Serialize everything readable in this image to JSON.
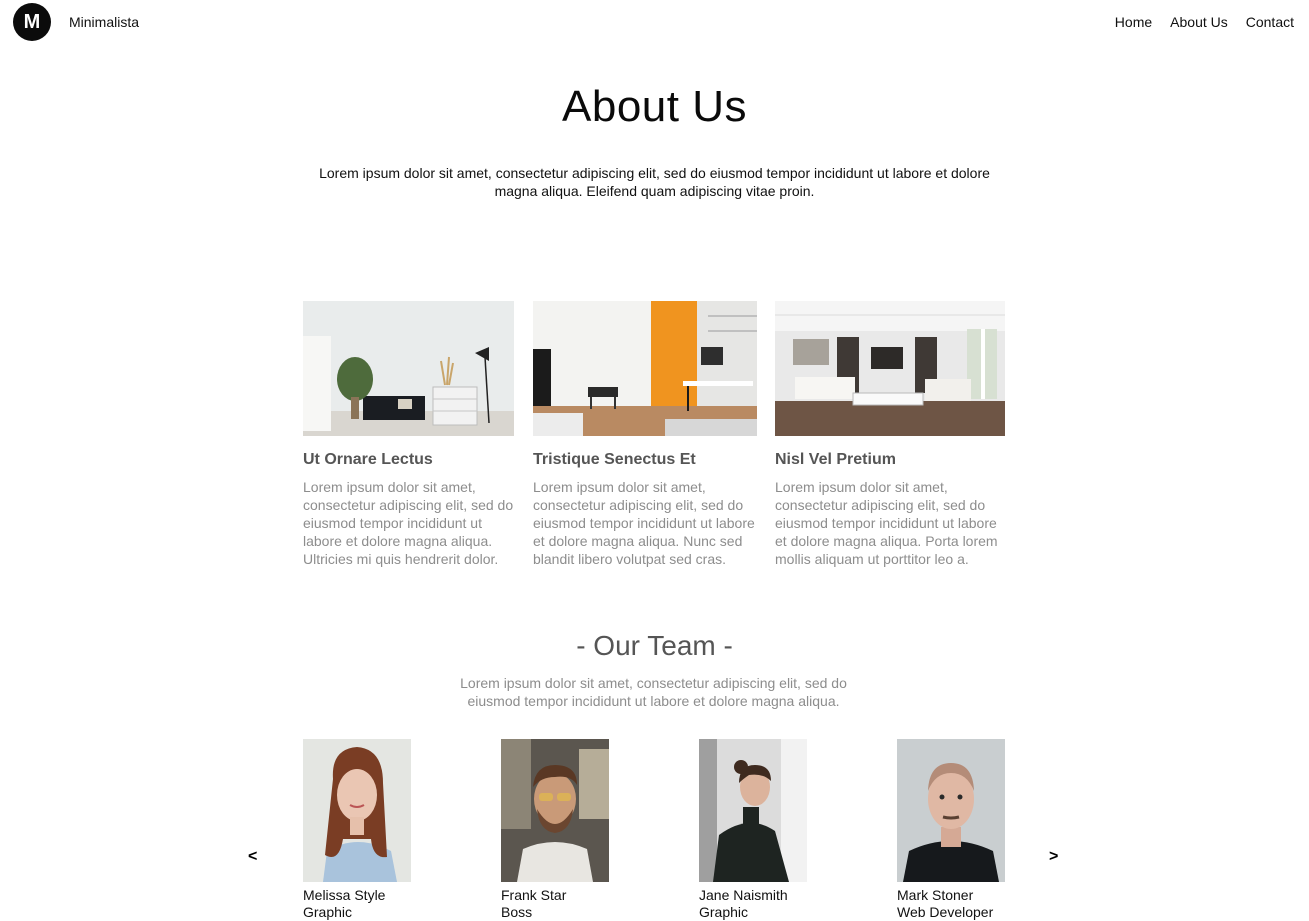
{
  "header": {
    "logo_letter": "M",
    "brand": "Minimalista",
    "nav": [
      "Home",
      "About Us",
      "Contact"
    ]
  },
  "hero": {
    "title": "About Us",
    "text": "Lorem ipsum dolor sit amet, consectetur adipiscing elit, sed do eiusmod tempor incididunt ut labore et dolore magna aliqua. Eleifend quam adipiscing vitae proin."
  },
  "features": [
    {
      "title": "Ut Ornare Lectus",
      "text": "Lorem ipsum dolor sit amet, consectetur adipiscing elit, sed do eiusmod tempor incididunt ut labore et dolore magna aliqua. Ultricies mi quis hendrerit dolor."
    },
    {
      "title": "Tristique Senectus Et",
      "text": "Lorem ipsum dolor sit amet, consectetur adipiscing elit, sed do eiusmod tempor incididunt ut labore et dolore magna aliqua. Nunc sed blandit libero volutpat sed cras."
    },
    {
      "title": "Nisl Vel Pretium",
      "text": "Lorem ipsum dolor sit amet, consectetur adipiscing elit, sed do eiusmod tempor incididunt ut labore et dolore magna aliqua. Porta lorem mollis aliquam ut porttitor leo a."
    }
  ],
  "team": {
    "title": "- Our Team -",
    "text": "Lorem ipsum dolor sit amet, consectetur adipiscing elit, sed do eiusmod tempor incididunt ut labore et dolore magna aliqua.",
    "prev": "<",
    "next": ">",
    "members": [
      {
        "name": "Melissa Style",
        "role": "Graphic"
      },
      {
        "name": "Frank Star",
        "role": "Boss"
      },
      {
        "name": "Jane Naismith",
        "role": "Graphic"
      },
      {
        "name": "Mark Stoner",
        "role": "Web Developer"
      }
    ]
  }
}
